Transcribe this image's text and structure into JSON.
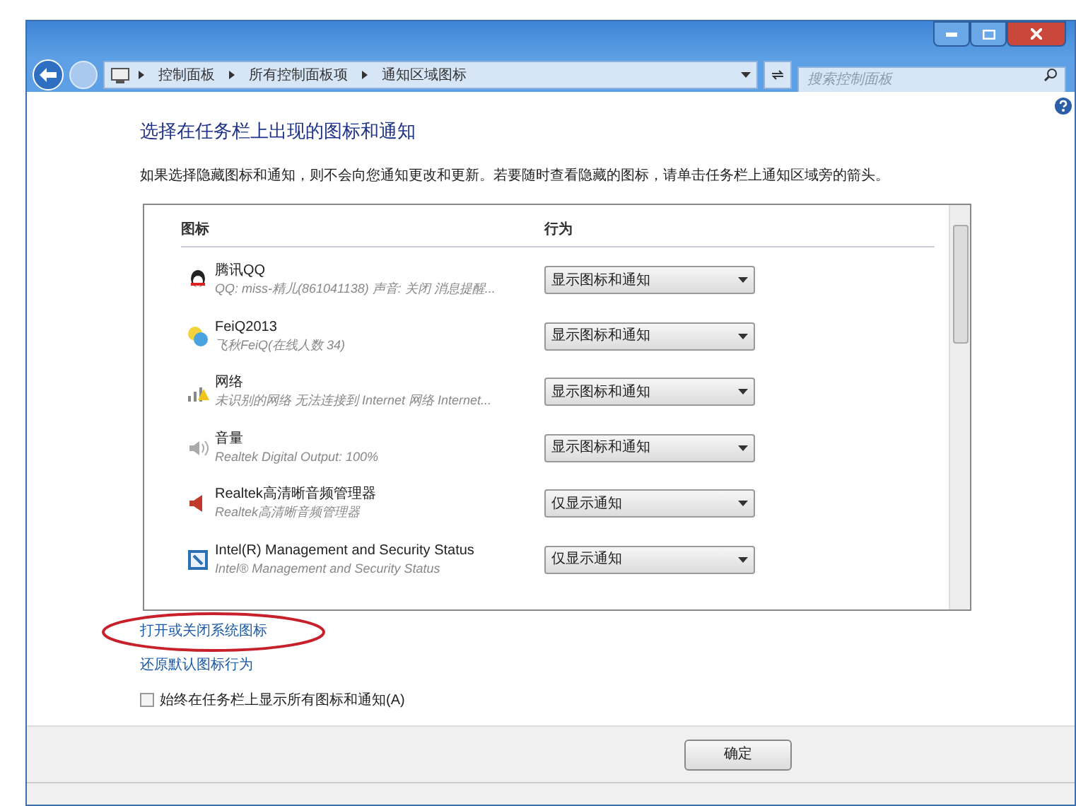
{
  "window": {
    "controls": [
      {
        "kind": "minimize"
      },
      {
        "kind": "maximize"
      },
      {
        "kind": "close"
      }
    ]
  },
  "address_bar": {
    "breadcrumbs": [
      "控制面板",
      "所有控制面板项",
      "通知区域图标"
    ],
    "search_placeholder": "搜索控制面板"
  },
  "heading": "选择在任务栏上出现的图标和通知",
  "description": "如果选择隐藏图标和通知，则不会向您通知更改和更新。若要随时查看隐藏的图标，请单击任务栏上通知区域旁的箭头。",
  "table": {
    "columns": [
      "图标",
      "行为"
    ],
    "rows": [
      {
        "kind": "qq",
        "name": "腾讯QQ",
        "detail": "QQ: miss-精儿(861041138) 声音: 关闭 消息提醒...",
        "behavior": "显示图标和通知"
      },
      {
        "kind": "feiq",
        "name": "FeiQ2013",
        "detail": "飞秋FeiQ(在线人数 34)",
        "behavior": "显示图标和通知"
      },
      {
        "kind": "network",
        "name": "网络",
        "detail": "未识别的网络 无法连接到 Internet 网络 Internet...",
        "behavior": "显示图标和通知"
      },
      {
        "kind": "volume",
        "name": "音量",
        "detail": "Realtek Digital Output: 100%",
        "behavior": "显示图标和通知"
      },
      {
        "kind": "speaker",
        "name": "Realtek高清晰音频管理器",
        "detail": "Realtek高清晰音频管理器",
        "behavior": "仅显示通知"
      },
      {
        "kind": "intel",
        "name": "Intel(R) Management and Security Status",
        "detail": "Intel® Management and Security Status",
        "behavior": "仅显示通知"
      }
    ]
  },
  "links": [
    {
      "text": "打开或关闭系统图标",
      "circled": true
    },
    {
      "text": "还原默认图标行为",
      "circled": false
    }
  ],
  "checkbox": {
    "label": "始终在任务栏上显示所有图标和通知(A)",
    "checked": false
  },
  "buttons": [
    "确定"
  ]
}
